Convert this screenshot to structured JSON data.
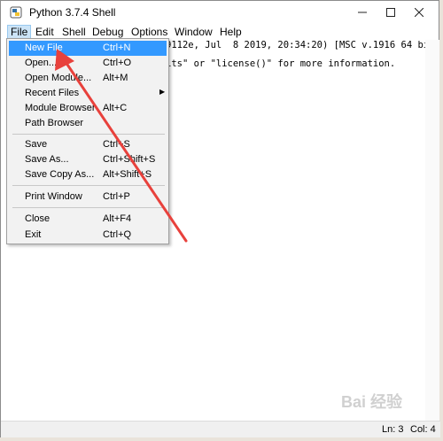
{
  "window": {
    "title": "Python 3.7.4 Shell"
  },
  "menubar": {
    "items": [
      "File",
      "Edit",
      "Shell",
      "Debug",
      "Options",
      "Window",
      "Help"
    ]
  },
  "editor": {
    "line1": "9112e, Jul  8 2019, 20:34:20) [MSC v.1916 64 bit",
    "line2": "its\" or \"license()\" for more information."
  },
  "file_menu": {
    "items": [
      {
        "label": "New File",
        "shortcut": "Ctrl+N"
      },
      {
        "label": "Open...",
        "shortcut": "Ctrl+O"
      },
      {
        "label": "Open Module...",
        "shortcut": "Alt+M"
      },
      {
        "label": "Recent Files",
        "shortcut": ""
      },
      {
        "label": "Module Browser",
        "shortcut": "Alt+C"
      },
      {
        "label": "Path Browser",
        "shortcut": ""
      },
      {
        "label": "Save",
        "shortcut": "Ctrl+S"
      },
      {
        "label": "Save As...",
        "shortcut": "Ctrl+Shift+S"
      },
      {
        "label": "Save Copy As...",
        "shortcut": "Alt+Shift+S"
      },
      {
        "label": "Print Window",
        "shortcut": "Ctrl+P"
      },
      {
        "label": "Close",
        "shortcut": "Alt+F4"
      },
      {
        "label": "Exit",
        "shortcut": "Ctrl+Q"
      }
    ],
    "submenu_indicator": "▶"
  },
  "status": {
    "line": "Ln: 3",
    "col": "Col: 4"
  },
  "watermark": "Bai 经验",
  "colors": {
    "selection": "#3399ff",
    "annotation_arrow": "#e8413c"
  }
}
